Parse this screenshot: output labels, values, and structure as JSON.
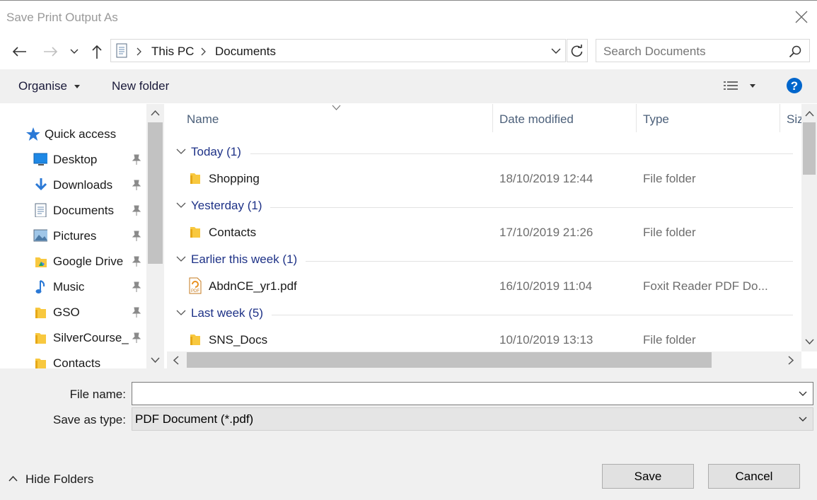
{
  "window": {
    "title": "Save Print Output As"
  },
  "address": {
    "crumbs": [
      "This PC",
      "Documents"
    ]
  },
  "search": {
    "placeholder": "Search Documents"
  },
  "toolbar": {
    "organise": "Organise",
    "new_folder": "New folder"
  },
  "sidebar": {
    "items": [
      {
        "label": "Quick access",
        "icon": "star-icon",
        "pinned": false
      },
      {
        "label": "Desktop",
        "icon": "desktop-icon",
        "pinned": true
      },
      {
        "label": "Downloads",
        "icon": "download-icon",
        "pinned": true
      },
      {
        "label": "Documents",
        "icon": "document-icon",
        "pinned": true
      },
      {
        "label": "Pictures",
        "icon": "pictures-icon",
        "pinned": true
      },
      {
        "label": "Google Drive",
        "icon": "google-drive-icon",
        "pinned": true
      },
      {
        "label": "Music",
        "icon": "music-icon",
        "pinned": true
      },
      {
        "label": "GSO",
        "icon": "folder-icon",
        "pinned": true
      },
      {
        "label": "SilverCourse_I",
        "icon": "folder-icon",
        "pinned": true
      },
      {
        "label": "Contacts",
        "icon": "folder-icon",
        "pinned": false
      }
    ]
  },
  "columns": {
    "name": "Name",
    "date": "Date modified",
    "type": "Type",
    "size": "Siz"
  },
  "groups": [
    {
      "label": "Today (1)",
      "files": [
        {
          "name": "Shopping",
          "date": "18/10/2019 12:44",
          "type": "File folder",
          "icon": "folder-icon"
        }
      ]
    },
    {
      "label": "Yesterday (1)",
      "files": [
        {
          "name": "Contacts",
          "date": "17/10/2019 21:26",
          "type": "File folder",
          "icon": "folder-icon"
        }
      ]
    },
    {
      "label": "Earlier this week (1)",
      "files": [
        {
          "name": "AbdnCE_yr1.pdf",
          "date": "16/10/2019 11:04",
          "type": "Foxit Reader PDF Do...",
          "icon": "pdf-icon"
        }
      ]
    },
    {
      "label": "Last week (5)",
      "files": [
        {
          "name": "SNS_Docs",
          "date": "10/10/2019 13:13",
          "type": "File folder",
          "icon": "folder-icon"
        }
      ]
    }
  ],
  "form": {
    "file_name_label": "File name:",
    "file_name_value": "",
    "save_type_label": "Save as type:",
    "save_type_value": "PDF Document (*.pdf)"
  },
  "footer": {
    "hide_folders": "Hide Folders",
    "save": "Save",
    "cancel": "Cancel"
  },
  "colors": {
    "accent": "#0066cc",
    "group_text": "#1e3287",
    "folder": "#f8c83f"
  }
}
